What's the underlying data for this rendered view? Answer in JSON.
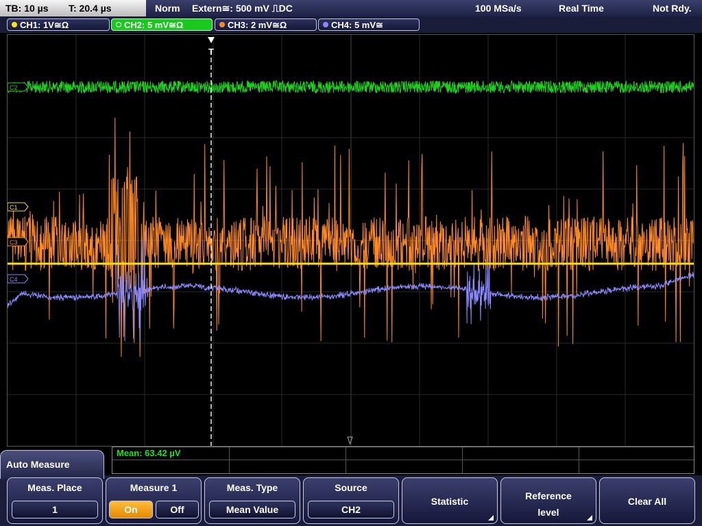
{
  "status": {
    "timebase": "TB: 10 µs",
    "trigger_time": "T: 20.4 µs",
    "trigger_mode": "Norm",
    "trigger_source": "Extern≅: 500 mV ⎍DC",
    "sample_rate": "100 MSa/s",
    "acq_mode": "Real Time",
    "state": "Not Rdy."
  },
  "channels": [
    {
      "label": "CH1: 1V≅Ω",
      "color": "#ffe400",
      "active": false
    },
    {
      "label": "CH2: 5 mV≅Ω",
      "color": "#1dd11d",
      "active": true
    },
    {
      "label": "CH3: 2 mV≅Ω",
      "color": "#ff8a24",
      "active": false
    },
    {
      "label": "CH4: 5 mV≅",
      "color": "#8a88ff",
      "active": false
    }
  ],
  "markers": {
    "c1": "C1",
    "c2": "C2",
    "c3": "C3",
    "c4": "C4",
    "trigger": "T"
  },
  "measurement": {
    "text": "Mean: 63.42 µV"
  },
  "menu": {
    "title": "Auto Measure",
    "meas_place": {
      "label": "Meas. Place",
      "value": "1"
    },
    "measure": {
      "label": "Measure 1",
      "on": "On",
      "off": "Off",
      "state": "On"
    },
    "meas_type": {
      "label": "Meas. Type",
      "value": "Mean Value"
    },
    "source": {
      "label": "Source",
      "value": "CH2"
    },
    "statistic": {
      "label": "Statistic"
    },
    "reference": {
      "line1": "Reference",
      "line2": "level"
    },
    "clear_all": {
      "label": "Clear All"
    }
  }
}
